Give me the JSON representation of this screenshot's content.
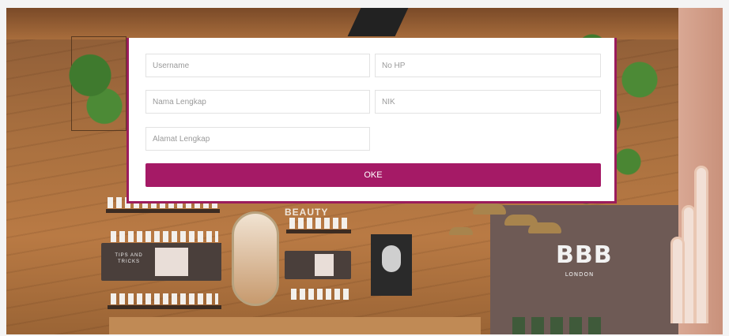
{
  "form": {
    "username": {
      "placeholder": "Username",
      "value": ""
    },
    "phone": {
      "placeholder": "No HP",
      "value": ""
    },
    "full_name": {
      "placeholder": "Nama Lengkap",
      "value": ""
    },
    "nik": {
      "placeholder": "NIK",
      "value": ""
    },
    "address": {
      "placeholder": "Alamat Lengkap",
      "value": ""
    },
    "submit_label": "OKE"
  },
  "background": {
    "logo_mark": "BBB",
    "logo_sub": "LONDON",
    "wall_sign": "BEAUTY",
    "display_text": "TIPS AND TRICKS"
  },
  "colors": {
    "accent": "#a51a66",
    "modal_border": "#9b1c5c"
  }
}
